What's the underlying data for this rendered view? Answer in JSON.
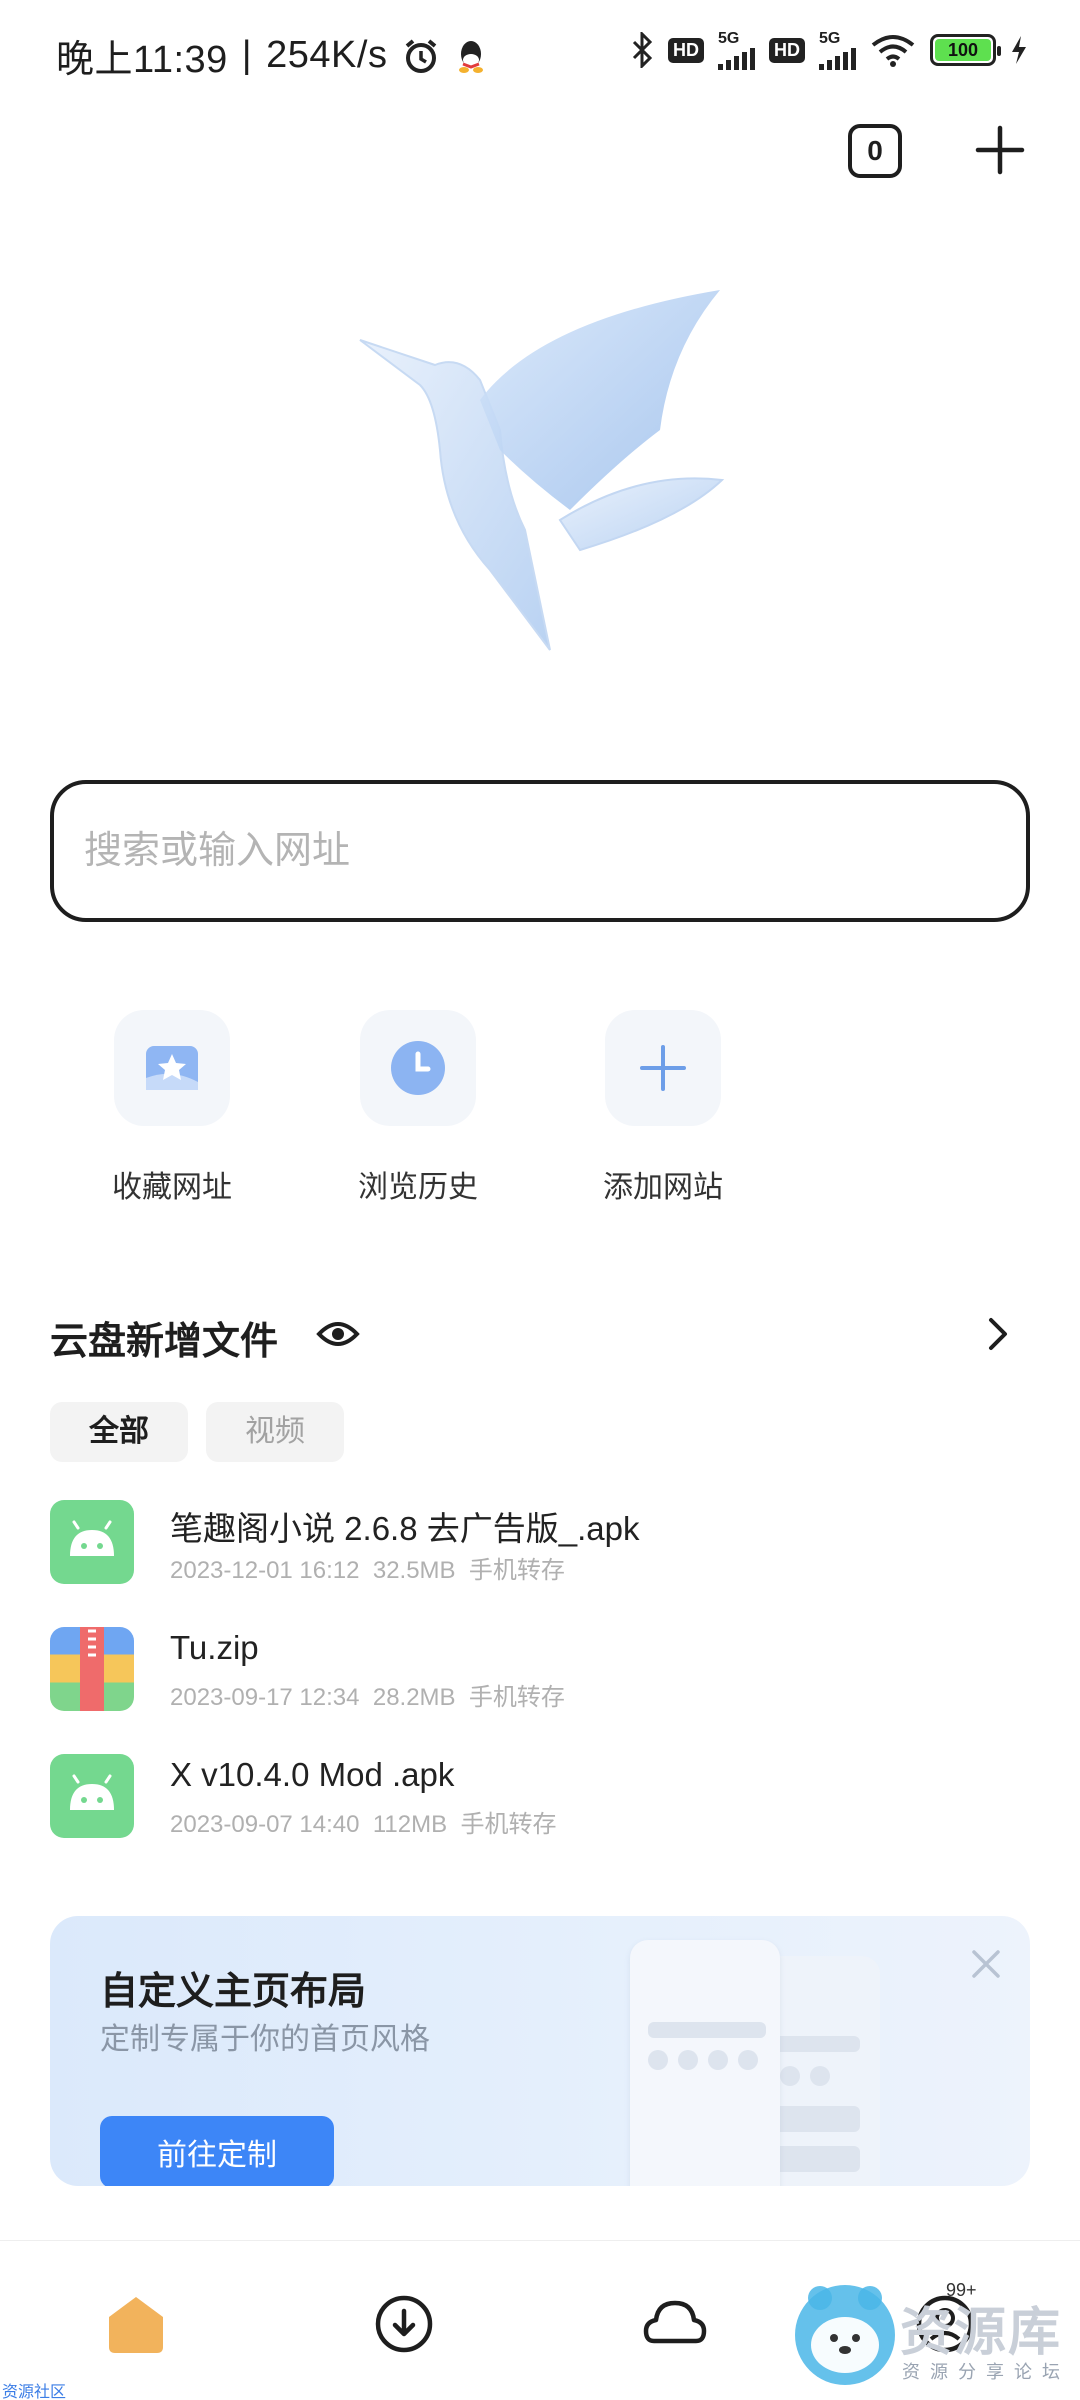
{
  "status_bar": {
    "time": "晚上11:39",
    "speed": "254K/s",
    "hd1": "HD",
    "hd2": "HD",
    "net1": "5G",
    "net2": "5G",
    "battery": "100"
  },
  "top_actions": {
    "tab_count": "0"
  },
  "search": {
    "placeholder": "搜索或输入网址"
  },
  "quick_actions": [
    {
      "label": "收藏网址",
      "icon": "bookmark-star-icon"
    },
    {
      "label": "浏览历史",
      "icon": "history-clock-icon"
    },
    {
      "label": "添加网站",
      "icon": "plus-icon"
    }
  ],
  "cloud": {
    "title": "云盘新增文件",
    "chips": [
      "全部",
      "视频"
    ],
    "files": [
      {
        "name": "笔趣阁小说 2.6.8 去广告版_.apk",
        "date": "2023-12-01 16:12",
        "size": "32.5MB",
        "source": "手机转存",
        "icon": "android-apk-icon"
      },
      {
        "name": "Tu.zip",
        "date": "2023-09-17 12:34",
        "size": "28.2MB",
        "source": "手机转存",
        "icon": "zip-archive-icon"
      },
      {
        "name": "X v10.4.0  Mod .apk",
        "date": "2023-09-07 14:40",
        "size": "112MB",
        "source": "手机转存",
        "icon": "android-apk-icon"
      }
    ]
  },
  "banner": {
    "title": "自定义主页布局",
    "subtitle": "定制专属于你的首页风格",
    "button": "前往定制"
  },
  "bottom_nav": {
    "badge": "99+"
  },
  "watermark": {
    "title": "资源库",
    "subtitle": "资源分享论坛",
    "corner": "资源社区"
  },
  "colors": {
    "accent": "#3d86f7",
    "home_icon": "#f2b35c",
    "android_green": "#74d88f"
  }
}
